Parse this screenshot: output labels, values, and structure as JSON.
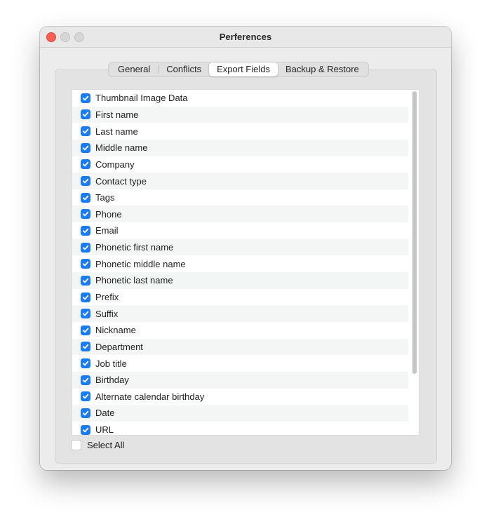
{
  "window": {
    "title": "Perferences"
  },
  "tabs": [
    {
      "label": "General",
      "active": false
    },
    {
      "label": "Conflicts",
      "active": false
    },
    {
      "label": "Export Fields",
      "active": true
    },
    {
      "label": "Backup & Restore",
      "active": false
    }
  ],
  "fields": [
    {
      "label": "Thumbnail Image Data",
      "checked": true
    },
    {
      "label": "First name",
      "checked": true
    },
    {
      "label": "Last name",
      "checked": true
    },
    {
      "label": "Middle name",
      "checked": true
    },
    {
      "label": "Company",
      "checked": true
    },
    {
      "label": "Contact type",
      "checked": true
    },
    {
      "label": "Tags",
      "checked": true
    },
    {
      "label": "Phone",
      "checked": true
    },
    {
      "label": "Email",
      "checked": true
    },
    {
      "label": "Phonetic first name",
      "checked": true
    },
    {
      "label": "Phonetic middle name",
      "checked": true
    },
    {
      "label": "Phonetic last name",
      "checked": true
    },
    {
      "label": "Prefix",
      "checked": true
    },
    {
      "label": "Suffix",
      "checked": true
    },
    {
      "label": "Nickname",
      "checked": true
    },
    {
      "label": "Department",
      "checked": true
    },
    {
      "label": "Job title",
      "checked": true
    },
    {
      "label": "Birthday",
      "checked": true
    },
    {
      "label": "Alternate calendar birthday",
      "checked": true
    },
    {
      "label": "Date",
      "checked": true
    },
    {
      "label": "URL",
      "checked": true
    }
  ],
  "select_all": {
    "label": "Select All",
    "checked": false
  },
  "colors": {
    "accent": "#1a7cf5",
    "close_button": "#fe5f57"
  }
}
